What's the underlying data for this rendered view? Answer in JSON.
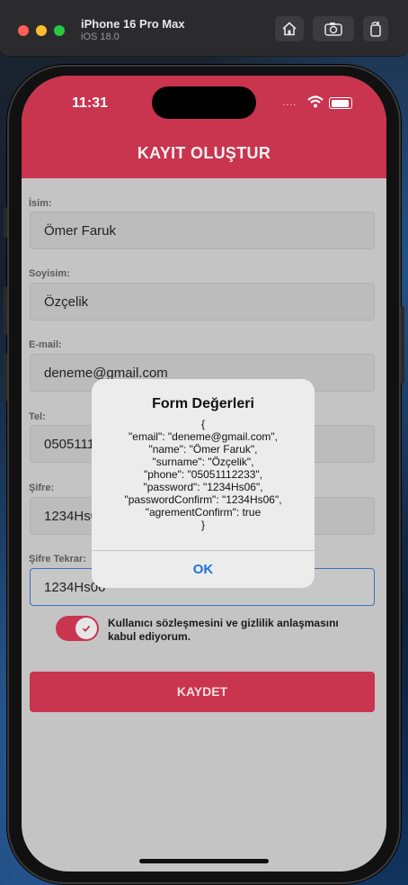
{
  "simulator": {
    "device_name": "iPhone 16 Pro Max",
    "os_version": "iOS 18.0",
    "icons": [
      "home-icon",
      "screenshot-icon",
      "rotate-icon"
    ]
  },
  "status_bar": {
    "time": "11:31",
    "signal": "...."
  },
  "header": {
    "title": "KAYIT OLUŞTUR"
  },
  "form": {
    "name_label": "İsim:",
    "name_value": "Ömer Faruk",
    "surname_label": "Soyisim:",
    "surname_value": "Özçelik",
    "email_label": "E-mail:",
    "email_value": "deneme@gmail.com",
    "phone_label": "Tel:",
    "phone_value": "05051112233",
    "password_label": "Şifre:",
    "password_value": "1234Hs06",
    "password_confirm_label": "Şifre Tekrar:",
    "password_confirm_value": "1234Hs06",
    "agreement_text": "Kullanıcı sözleşmesini ve gizlilik anlaşmasını kabul ediyorum.",
    "agreement_checked": true,
    "submit_label": "KAYDET"
  },
  "alert": {
    "title": "Form Değerleri",
    "lines": [
      "{",
      "\"email\": \"deneme@gmail.com\",",
      "\"name\": \"Ömer Faruk\",",
      "\"surname\": \"Özçelik\",",
      "\"phone\": \"05051112233\",",
      "\"password\": \"1234Hs06\",",
      "\"passwordConfirm\": \"1234Hs06\",",
      "\"agrementConfirm\": true",
      "}"
    ],
    "ok_label": "OK"
  },
  "colors": {
    "accent": "#c9344f",
    "link_blue": "#1a73d9",
    "input_focus": "#3e6fc6"
  }
}
